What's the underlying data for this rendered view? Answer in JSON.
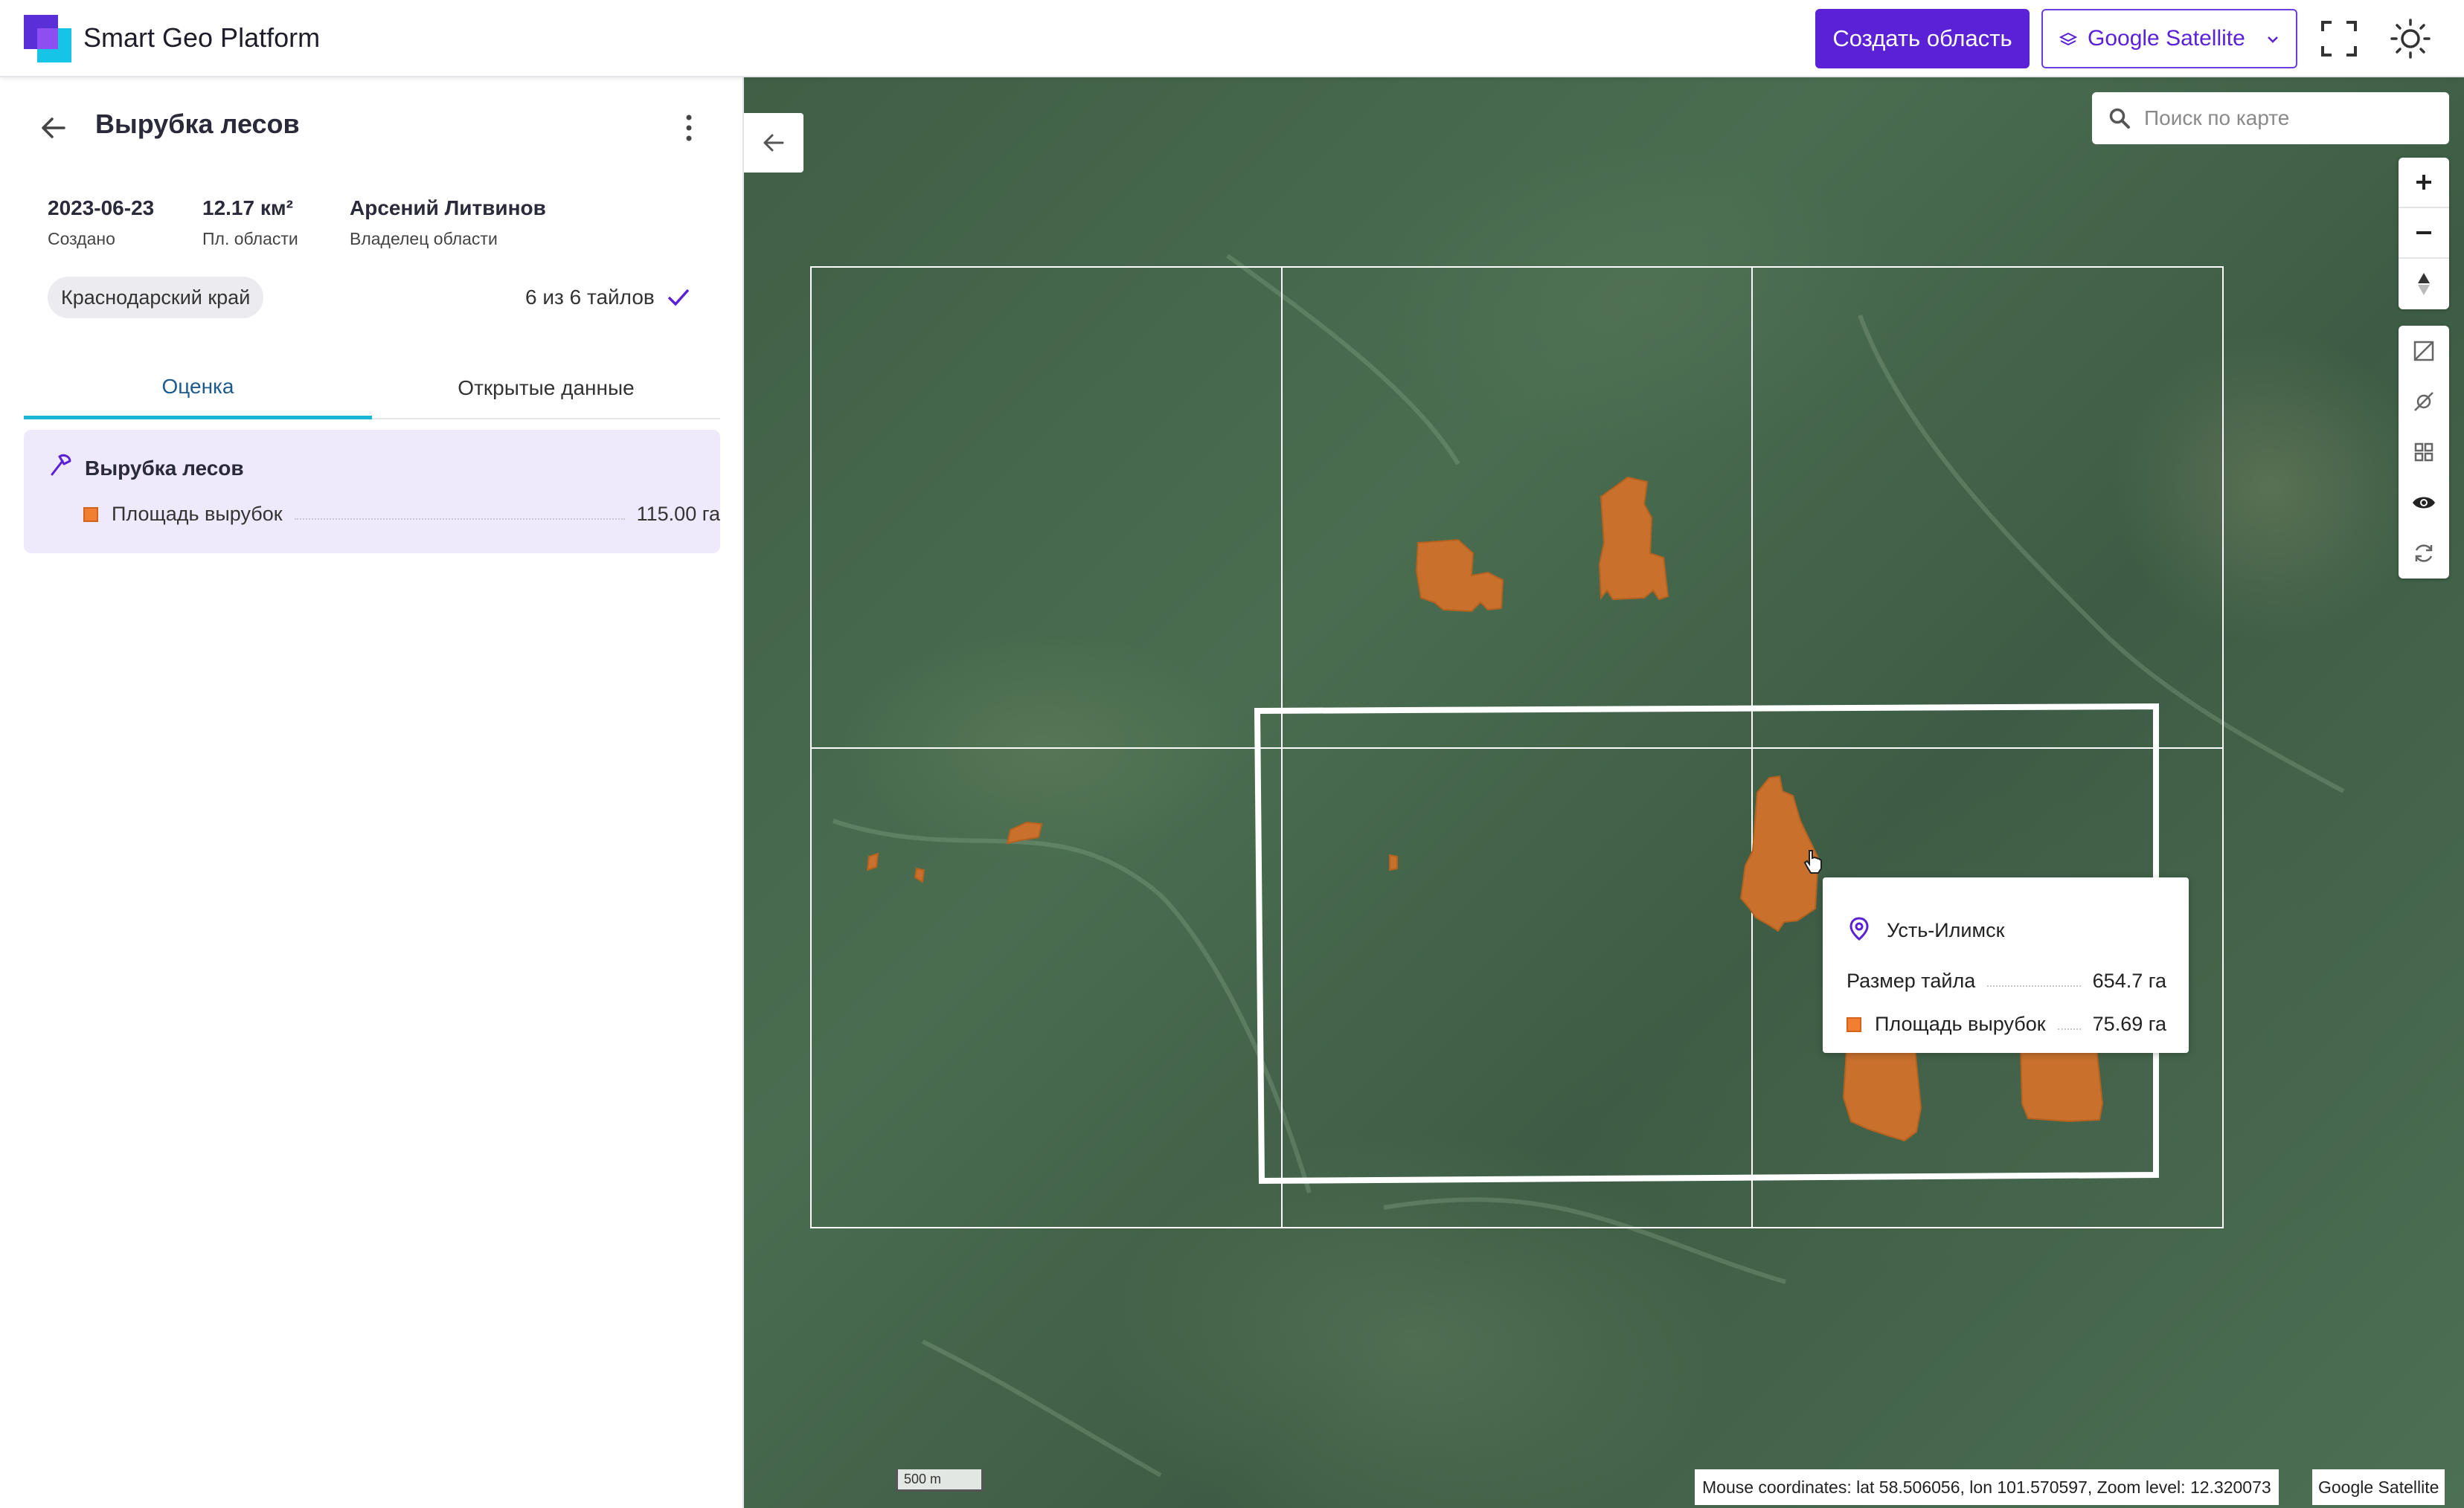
{
  "header": {
    "brand": "Smart Geo Platform",
    "create_button": "Создать область",
    "layer_select": "Google Satellite",
    "accent": "#5b21d6",
    "icons": [
      "logo-icon",
      "layers-icon",
      "chevron-down-icon",
      "fullscreen-icon",
      "theme-sun-icon"
    ]
  },
  "sidebar": {
    "title": "Вырубка лесов",
    "meta": [
      {
        "value": "2023-06-23",
        "label": "Создано"
      },
      {
        "value": "12.17 км²",
        "label": "Пл. области"
      },
      {
        "value": "Арсений Литвинов",
        "label": "Владелец области"
      }
    ],
    "region": "Краснодарский край",
    "tiles_status": "6 из 6 тайлов",
    "tabs": [
      {
        "label": "Оценка",
        "active": true
      },
      {
        "label": "Открытые данные",
        "active": false
      }
    ],
    "card": {
      "title": "Вырубка лесов",
      "metric_label": "Площадь вырубок",
      "metric_value": "115.00 га",
      "swatch_color": "#f07f32"
    }
  },
  "map": {
    "search_placeholder": "Поиск по карте",
    "tooltip": {
      "city": "Усть-Илимск",
      "rows": [
        {
          "label": "Размер тайла",
          "value": "654.7 га"
        },
        {
          "label": "Площадь вырубок",
          "value": "75.69 га"
        }
      ]
    },
    "scale_label": "500 m",
    "coords": "Mouse coordinates: lat 58.506056, lon 101.570597, Zoom level: 12.320073",
    "attribution": "Google Satellite",
    "cutting_color": "#c8702c",
    "controls": [
      "zoom-in-icon",
      "zoom-out-icon",
      "compass-icon",
      "hide-polygon-icon",
      "hide-points-icon",
      "grid-icon",
      "eye-icon",
      "refresh-icon"
    ]
  }
}
